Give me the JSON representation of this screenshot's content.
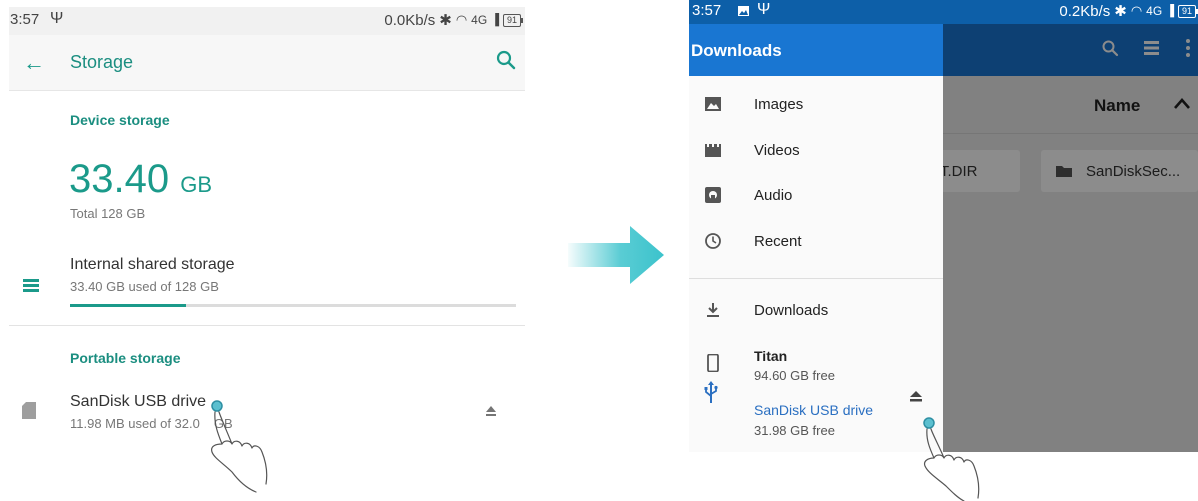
{
  "left": {
    "status": {
      "time": "3:57",
      "speed": "0.0Kb/s",
      "network": "4G",
      "battery": "91"
    },
    "appbar": {
      "title": "Storage"
    },
    "device_storage": {
      "header": "Device storage",
      "used_value": "33.40",
      "used_unit": "GB",
      "total": "Total 128 GB",
      "internal": {
        "title": "Internal shared storage",
        "subtitle": "33.40 GB used of 128 GB",
        "fill_fraction": 0.26
      }
    },
    "portable_storage": {
      "header": "Portable storage",
      "drive": {
        "title": "SanDisk USB drive",
        "subtitle_a": "11.98 MB used of 32.0",
        "subtitle_b": "GB"
      }
    }
  },
  "right": {
    "status": {
      "time": "3:57",
      "speed": "0.2Kb/s",
      "network": "4G",
      "battery": "91"
    },
    "drawer": {
      "title": "Downloads",
      "items": [
        {
          "label": "Images",
          "icon": "image-icon"
        },
        {
          "label": "Videos",
          "icon": "video-icon"
        },
        {
          "label": "Audio",
          "icon": "audio-icon"
        },
        {
          "label": "Recent",
          "icon": "clock-icon"
        }
      ],
      "downloads": "Downloads",
      "titan": {
        "title": "Titan",
        "subtitle": "94.60 GB free"
      },
      "sandisk": {
        "title": "SanDisk USB drive",
        "subtitle": "31.98 GB free"
      }
    },
    "content": {
      "sort_label": "Name",
      "chip1": "T.DIR",
      "chip2": "SanDiskSec..."
    }
  },
  "colors": {
    "teal": "#1b9a8a",
    "blue": "#1976d2",
    "arrow": "#3cc3cc"
  }
}
